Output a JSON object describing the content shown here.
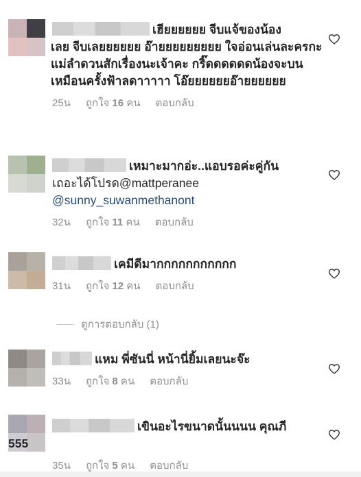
{
  "comments": [
    {
      "text_line1": "เฮียยยยยย จีบแจ้ของน้อง",
      "text_rest": "เลย จีบเลยยยยยย อ๊ายยยยยยยยย ใจอ่อนเล่นละครกะแม่ลำดวนสักเรื่องนะเจ้าคะ กริ๊ดดดดดดน้องจะบนเหมือนครั้งฟ้าลดาาาาา โอ๊ยยยยยยอ๊ายยยยยย",
      "time": "25น",
      "likes_prefix": "ถูกใจ",
      "likes_count": "16",
      "likes_suffix": "คน",
      "reply": "ตอบกลับ"
    },
    {
      "text_line1": "เหมาะมากอ่ะ..แอบรอค่ะคู่กัน",
      "text_line2": "เถอะได้โปรด@mattperanee",
      "mention": "@sunny_suwanmethanont",
      "time": "32น",
      "likes_prefix": "ถูกใจ",
      "likes_count": "11",
      "likes_suffix": "คน",
      "reply": "ตอบกลับ"
    },
    {
      "text_line1": "เคมีดีมากกกกกกกกกกก",
      "time": "31น",
      "likes_prefix": "ถูกใจ",
      "likes_count": "12",
      "likes_suffix": "คน",
      "reply": "ตอบกลับ"
    },
    {
      "text_line1": "แหม พี่ซันนี่ หน้านี่ยิ้มเลยนะจ๊ะ",
      "time": "33น",
      "likes_prefix": "ถูกใจ",
      "likes_count": "8",
      "likes_suffix": "คน",
      "reply": "ตอบกลับ"
    },
    {
      "text_line1": "เขินอะไรขนาดนั้นนนน คุณภี",
      "text_line2": "555",
      "time": "35น",
      "likes_prefix": "ถูกใจ",
      "likes_count": "5",
      "likes_suffix": "คน",
      "reply": "ตอบกลับ"
    }
  ],
  "view_replies": "ดูการตอบกลับ (1)",
  "icons": {
    "like": "heart-outline-icon"
  },
  "colors": {
    "text": "#262626",
    "meta": "#8e8e8e",
    "mention": "#274c77"
  }
}
